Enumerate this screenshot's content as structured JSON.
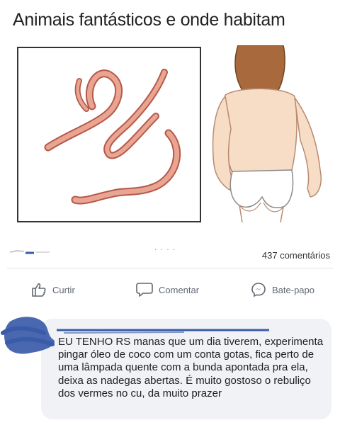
{
  "post": {
    "title": "Animais fantásticos e onde habitam"
  },
  "stats": {
    "dots": ". . . .",
    "comments": "437 comentários"
  },
  "actions": {
    "like": "Curtir",
    "comment": "Comentar",
    "chat": "Bate-papo"
  },
  "comment": {
    "text": "EU TENHO RS manas que um dia tiverem, experimenta pingar óleo de coco com um conta gotas, fica perto de uma lâmpada quente com a bunda apontada pra ela, deixa as nadegas abertas. É muito gostoso o rebuliço dos vermes no cu, da muito prazer"
  },
  "colors": {
    "worm_fill": "#e9a592",
    "worm_outline": "#b4594a",
    "skin": "#f7dcc6",
    "hair": "#a86a3c",
    "scribble": "#3a5ba8",
    "bubble": "#f0f2f5",
    "action_text": "#606770"
  },
  "icons": {
    "like": "thumbs-up-icon",
    "comment": "speech-bubble-icon",
    "chat": "messenger-icon"
  }
}
